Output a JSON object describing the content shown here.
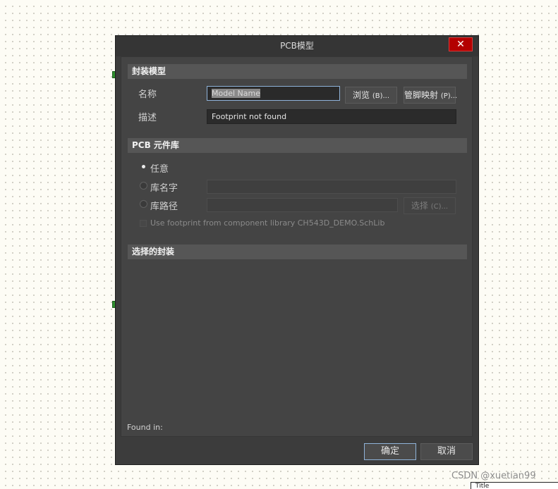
{
  "dialog": {
    "title": "PCB模型",
    "close_symbol": "✕"
  },
  "footprint_model": {
    "header": "封装模型",
    "name_label": "名称",
    "name_placeholder": "Model Name",
    "browse_label": "浏览",
    "browse_hotkey": "(B)...",
    "pin_map_label": "管脚映射",
    "pin_map_hotkey": "(P)...",
    "desc_label": "描述",
    "desc_value": "Footprint not found"
  },
  "pcb_library": {
    "header": "PCB 元件库",
    "options": [
      {
        "label": "任意",
        "checked": true
      },
      {
        "label": "库名字",
        "checked": false
      },
      {
        "label": "库路径",
        "checked": false
      }
    ],
    "select_label": "选择",
    "select_hotkey": "(C)...",
    "use_footprint_label": "Use footprint from component library CH543D_DEMO.SchLib"
  },
  "selected_footprint": {
    "header": "选择的封装",
    "found_in_label": "Found in:"
  },
  "footer": {
    "ok_label": "确定",
    "cancel_label": "取消"
  },
  "background": {
    "watermark": "CSDN @xuetian99",
    "title_stub": "Title"
  },
  "colors": {
    "dialog_bg": "#3c3c3c",
    "close_button": "#b30000",
    "focus_border": "#8fb3d9"
  }
}
